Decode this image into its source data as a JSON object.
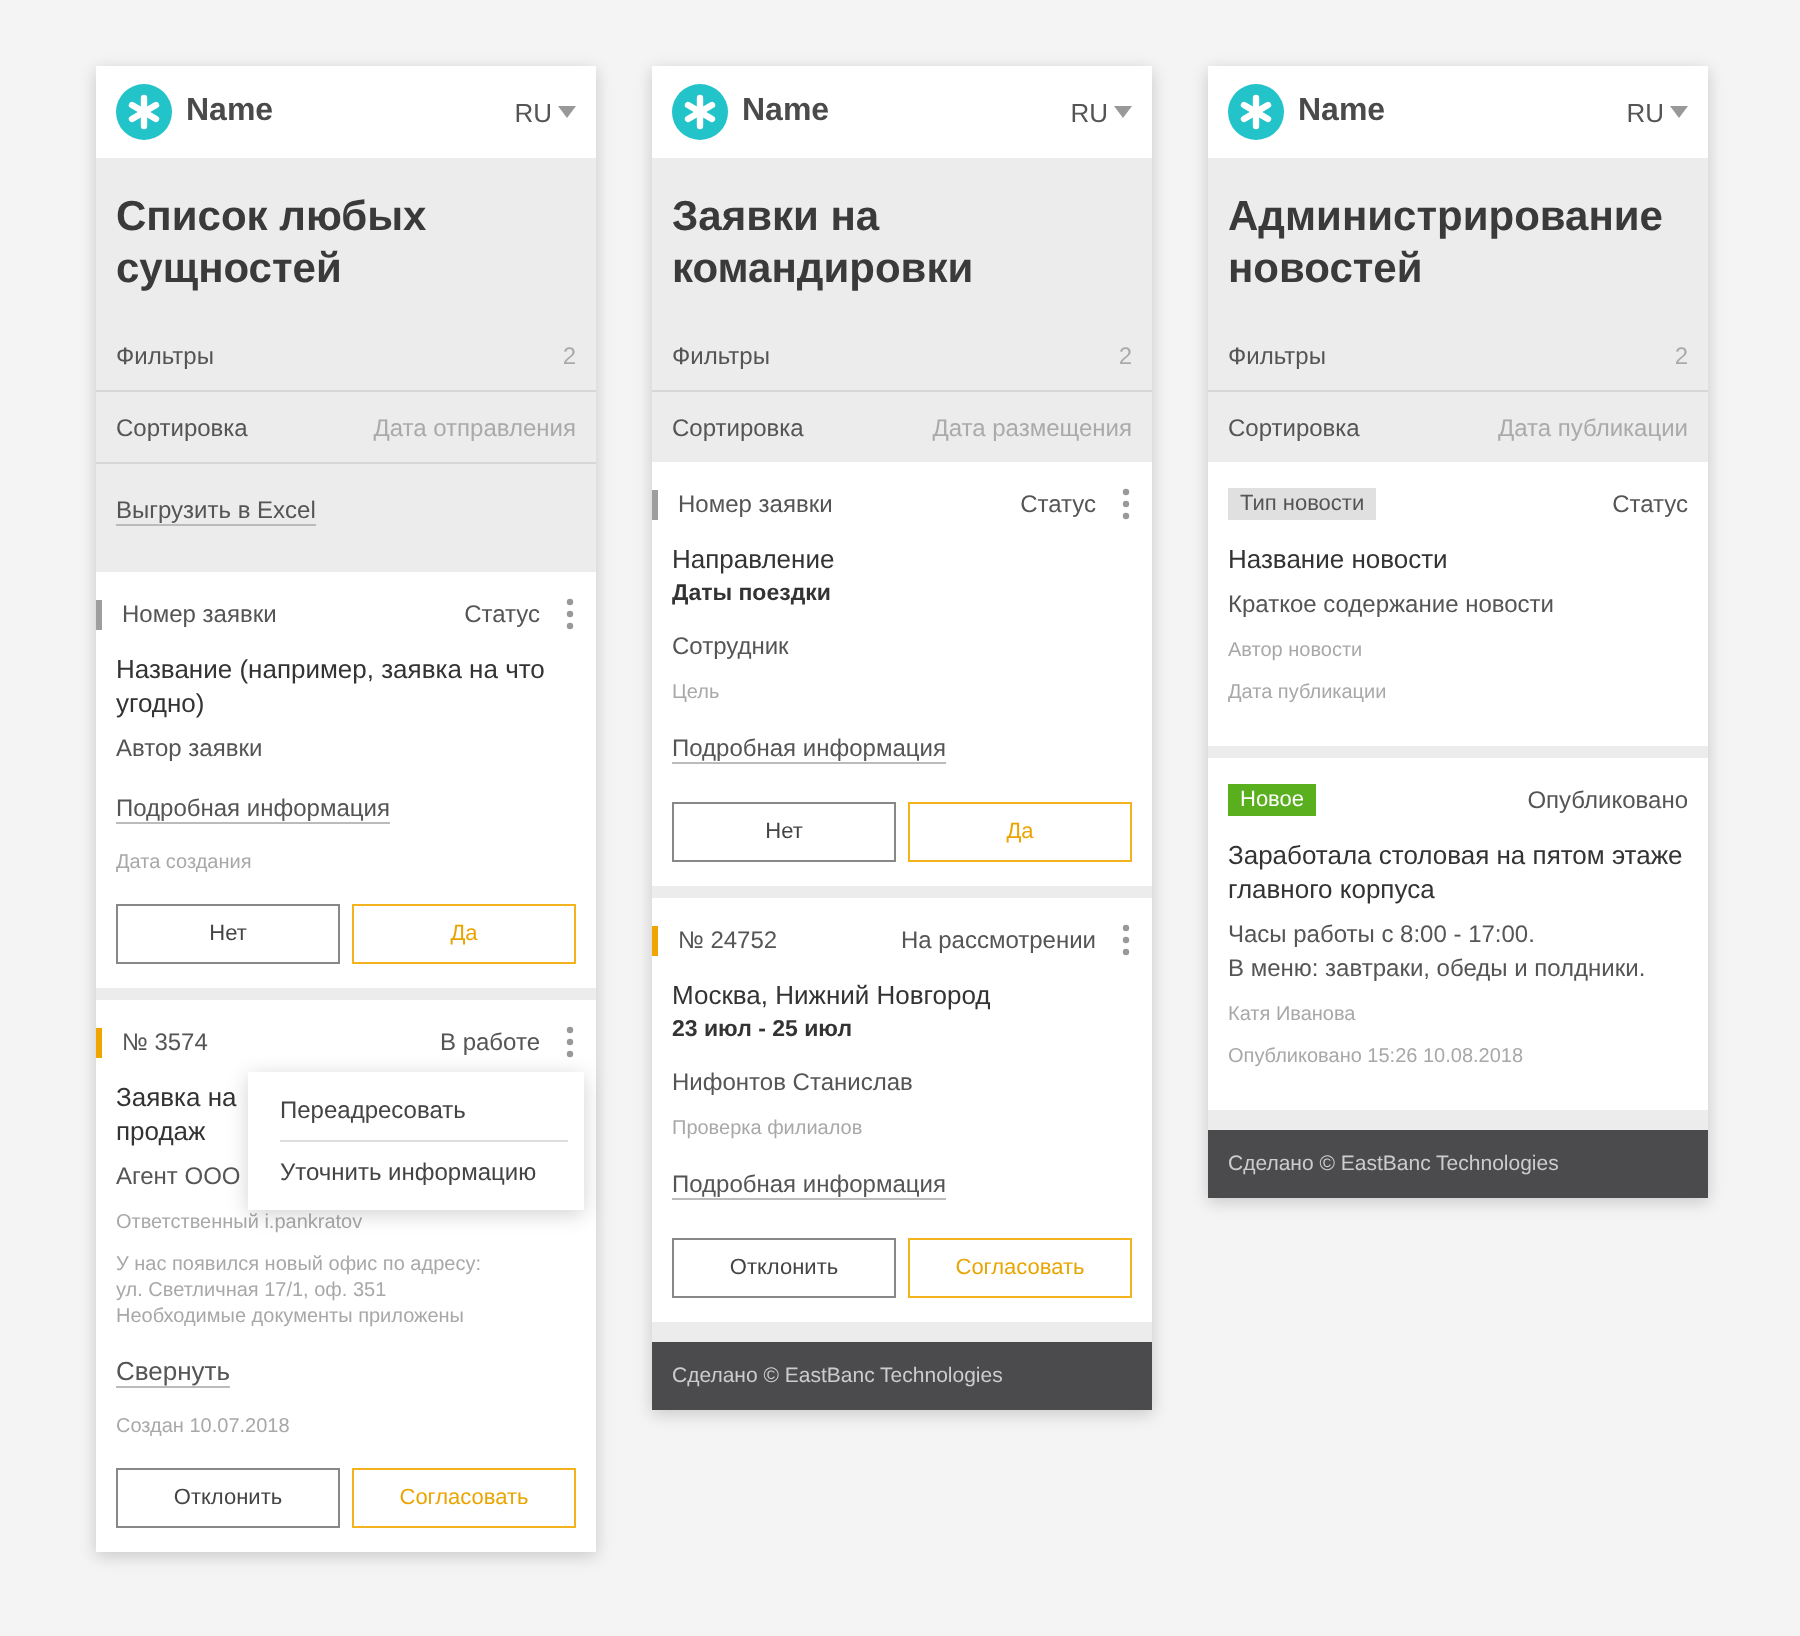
{
  "screens": [
    {
      "header": {
        "brand": "Name",
        "language": "RU"
      },
      "title": "Список любых сущностей",
      "filters": {
        "label": "Фильтры",
        "count": "2"
      },
      "sort": {
        "label": "Сортировка",
        "value": "Дата отправления"
      },
      "export_link": "Выгрузить в Excel",
      "cards": [
        {
          "number": "Номер заявки",
          "color": "#9e9e9e",
          "status": "Статус",
          "has_menu": true,
          "menu_open": false,
          "lines": [
            {
              "kind": "title",
              "text": "Название (например, заявка на что угодно)"
            },
            {
              "kind": "text",
              "text": "Автор заявки"
            },
            {
              "kind": "link",
              "text": "Подробная информация"
            },
            {
              "kind": "muted",
              "text": "Дата создания"
            }
          ],
          "buttons": [
            {
              "kind": "secondary",
              "label": "Нет"
            },
            {
              "kind": "primary",
              "label": "Да"
            }
          ]
        },
        {
          "number": "№ 3574",
          "color": "#f0a500",
          "status": "В работе",
          "has_menu": true,
          "menu_open": true,
          "menu": [
            "Переадресовать",
            "Уточнить информацию"
          ],
          "lines": [
            {
              "kind": "title",
              "text": "Заявка на продаж"
            },
            {
              "kind": "text",
              "text": "Агент ООО"
            },
            {
              "kind": "muted",
              "text": "Ответственный i.pankratov"
            },
            {
              "kind": "muted",
              "text": "У нас появился новый офис по адресу:\nул. Светличная 17/1, оф. 351\nНеобходимые документы приложены"
            },
            {
              "kind": "link",
              "text": "Свернуть"
            },
            {
              "kind": "muted",
              "text": "Создан 10.07.2018"
            }
          ],
          "buttons": [
            {
              "kind": "secondary",
              "label": "Отклонить"
            },
            {
              "kind": "primary",
              "label": "Согласовать"
            }
          ]
        }
      ]
    },
    {
      "header": {
        "brand": "Name",
        "language": "RU"
      },
      "title": "Заявки на командировки",
      "filters": {
        "label": "Фильтры",
        "count": "2"
      },
      "sort": {
        "label": "Сортировка",
        "value": "Дата размещения"
      },
      "cards": [
        {
          "number": "Номер заявки",
          "color": "#9e9e9e",
          "status": "Статус",
          "has_menu": true,
          "menu_open": false,
          "lines": [
            {
              "kind": "title",
              "text": "Направление"
            },
            {
              "kind": "bold",
              "text": "Даты поездки"
            },
            {
              "kind": "text",
              "text": "Сотрудник"
            },
            {
              "kind": "muted",
              "text": "Цель"
            },
            {
              "kind": "link",
              "text": "Подробная информация"
            }
          ],
          "buttons": [
            {
              "kind": "secondary",
              "label": "Нет"
            },
            {
              "kind": "primary",
              "label": "Да"
            }
          ]
        },
        {
          "number": "№ 24752",
          "color": "#f0a500",
          "status": "На рассмотрении",
          "has_menu": true,
          "menu_open": false,
          "lines": [
            {
              "kind": "title",
              "text": "Москва, Нижний Новгород"
            },
            {
              "kind": "bold",
              "text": "23 июл - 25 июл"
            },
            {
              "kind": "text",
              "text": "Нифонтов Станислав"
            },
            {
              "kind": "muted",
              "text": "Проверка филиалов"
            },
            {
              "kind": "link",
              "text": "Подробная информация"
            }
          ],
          "buttons": [
            {
              "kind": "secondary",
              "label": "Отклонить"
            },
            {
              "kind": "primary",
              "label": "Согласовать"
            }
          ]
        }
      ],
      "footer": "Сделано © EastBanc Technologies"
    },
    {
      "header": {
        "brand": "Name",
        "language": "RU"
      },
      "title": "Администрирование новостей",
      "filters": {
        "label": "Фильтры",
        "count": "2"
      },
      "sort": {
        "label": "Сортировка",
        "value": "Дата публикации"
      },
      "cards": [
        {
          "tag": {
            "label": "Тип новости",
            "color": "#e0e0e0"
          },
          "status": "Статус",
          "lines": [
            {
              "kind": "title",
              "text": "Название новости"
            },
            {
              "kind": "text",
              "text": "Краткое содержание новости"
            },
            {
              "kind": "muted",
              "text": "Автор новости"
            },
            {
              "kind": "muted",
              "text": "Дата публикации"
            }
          ]
        },
        {
          "tag": {
            "label": "Новое",
            "color": "#5aaf1e"
          },
          "status": "Опубликовано",
          "lines": [
            {
              "kind": "title",
              "text": "Заработала столовая на пятом этаже главного корпуса"
            },
            {
              "kind": "text",
              "text": "Часы работы с 8:00 - 17:00.\nВ меню: завтраки, обеды и полдники."
            },
            {
              "kind": "muted",
              "text": "Катя Иванова"
            },
            {
              "kind": "muted",
              "text": "Опубликовано 15:26  10.08.2018"
            }
          ]
        }
      ],
      "footer": "Сделано © EastBanc Technologies"
    }
  ]
}
